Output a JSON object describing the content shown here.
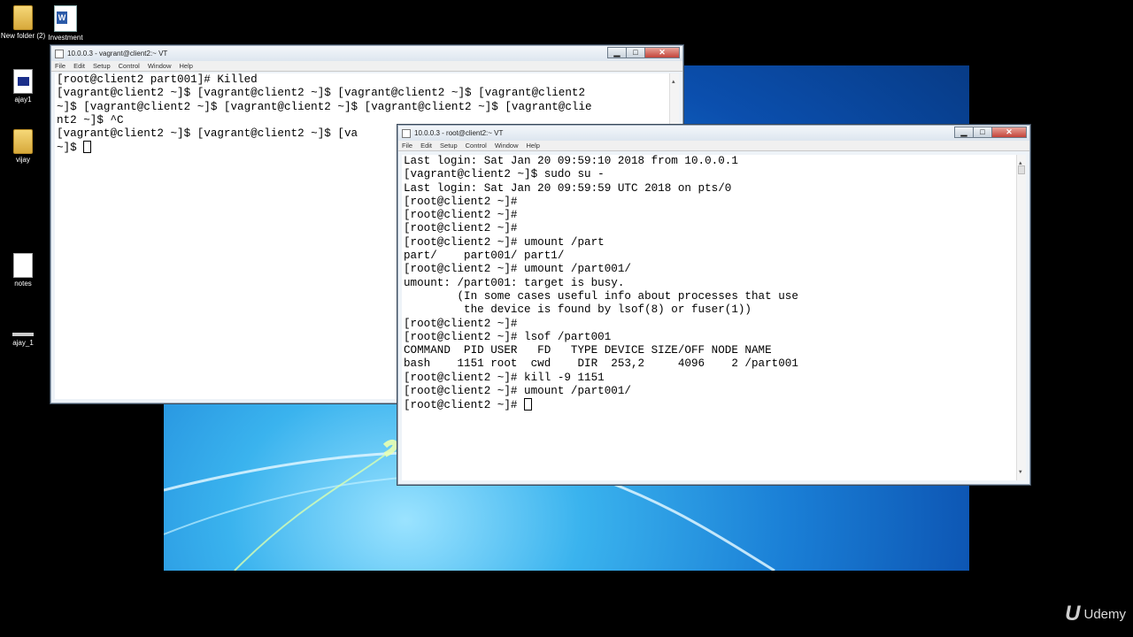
{
  "desktop": {
    "icons": [
      {
        "label": "New folder (2)"
      },
      {
        "label": "Investment"
      },
      {
        "label": "ajay1"
      },
      {
        "label": "vijay"
      },
      {
        "label": "notes"
      },
      {
        "label": "ajay_1"
      }
    ],
    "word_icon_letter": "W"
  },
  "window_back": {
    "title": "10.0.0.3 - vagrant@client2:~ VT",
    "menu": [
      "File",
      "Edit",
      "Setup",
      "Control",
      "Window",
      "Help"
    ],
    "lines": [
      "[root@client2 part001]# Killed",
      "[vagrant@client2 ~]$ [vagrant@client2 ~]$ [vagrant@client2 ~]$ [vagrant@client2",
      "~]$ [vagrant@client2 ~]$ [vagrant@client2 ~]$ [vagrant@client2 ~]$ [vagrant@clie",
      "nt2 ~]$ ^C",
      "[vagrant@client2 ~]$ [vagrant@client2 ~]$ [va",
      "~]$ "
    ]
  },
  "window_front": {
    "title": "10.0.0.3 - root@client2:~ VT",
    "menu": [
      "File",
      "Edit",
      "Setup",
      "Control",
      "Window",
      "Help"
    ],
    "lines": [
      "Last login: Sat Jan 20 09:59:10 2018 from 10.0.0.1",
      "[vagrant@client2 ~]$ sudo su -",
      "Last login: Sat Jan 20 09:59:59 UTC 2018 on pts/0",
      "[root@client2 ~]#",
      "[root@client2 ~]#",
      "[root@client2 ~]#",
      "[root@client2 ~]# umount /part",
      "part/    part001/ part1/",
      "[root@client2 ~]# umount /part001/",
      "umount: /part001: target is busy.",
      "        (In some cases useful info about processes that use",
      "         the device is found by lsof(8) or fuser(1))",
      "[root@client2 ~]#",
      "[root@client2 ~]# lsof /part001",
      "COMMAND  PID USER   FD   TYPE DEVICE SIZE/OFF NODE NAME",
      "bash    1151 root  cwd    DIR  253,2     4096    2 /part001",
      "[root@client2 ~]# kill -9 1151",
      "[root@client2 ~]# umount /part001/",
      "[root@client2 ~]# "
    ]
  },
  "window_controls": {
    "minimize": "▁",
    "maximize": "□",
    "close": "✕"
  },
  "scroll_arrows": {
    "up": "▲",
    "down": "▼"
  },
  "watermark": {
    "logo": "U",
    "text": "Udemy"
  },
  "colors": {
    "wallpaper": "#1a7fd6",
    "terminal_bg": "#ffffff",
    "titlebar": "#dde6ef"
  }
}
